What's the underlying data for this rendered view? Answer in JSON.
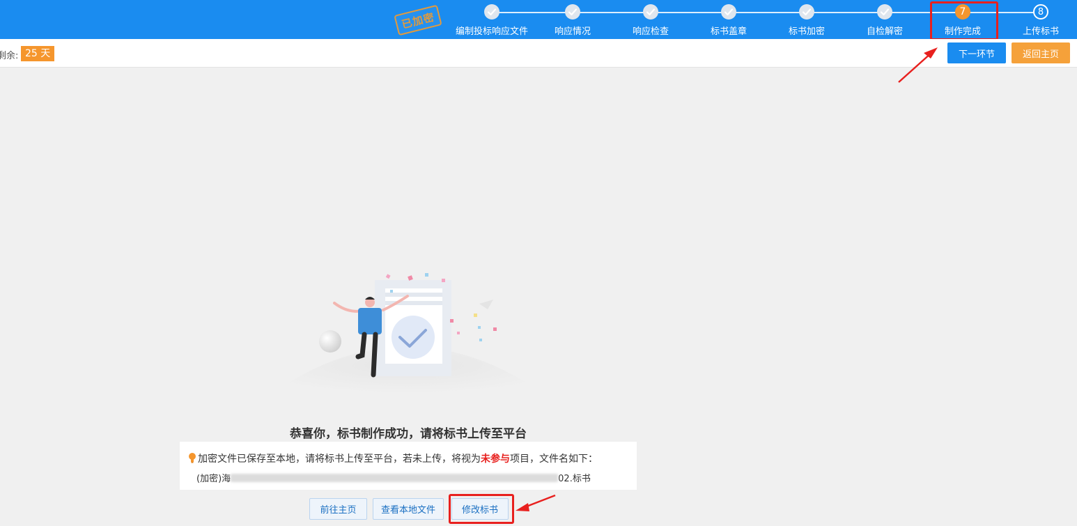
{
  "header": {
    "stamp_text": "已加密",
    "steps": [
      {
        "label": "编制投标响应文件",
        "state": "done",
        "marker": ""
      },
      {
        "label": "响应情况",
        "state": "done",
        "marker": ""
      },
      {
        "label": "响应检查",
        "state": "done",
        "marker": ""
      },
      {
        "label": "标书盖章",
        "state": "done",
        "marker": ""
      },
      {
        "label": "标书加密",
        "state": "done",
        "marker": ""
      },
      {
        "label": "自检解密",
        "state": "done",
        "marker": ""
      },
      {
        "label": "制作完成",
        "state": "current",
        "marker": "7"
      },
      {
        "label": "上传标书",
        "state": "todo",
        "marker": "8"
      }
    ],
    "current_step": 7
  },
  "subbar": {
    "remaining_label": "剩余:",
    "remaining_value": "25 天",
    "next_button": "下一环节",
    "home_button": "返回主页"
  },
  "main": {
    "success_title": "恭喜你，标书制作成功，请将标书上传至平台",
    "notice_part1": "加密文件已保存至本地，请将标书上传至平台，若未上传，将视为",
    "notice_warning": "未参与",
    "notice_part2": "项目，文件名如下：",
    "filename_prefix": "(加密)海",
    "filename_suffix": "02.标书",
    "buttons": {
      "go_home": "前往主页",
      "view_local": "查看本地文件",
      "modify": "修改标书"
    }
  },
  "colors": {
    "primary": "#1a8cf0",
    "accent": "#f5962d",
    "annotation": "#e8201e"
  }
}
